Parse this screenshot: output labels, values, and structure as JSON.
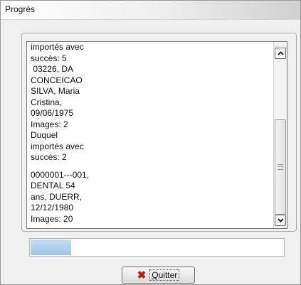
{
  "window": {
    "title": "Progrès"
  },
  "log": {
    "block1": "importés avec\nsuccès: 5\n 03226, DA\nCONCEICAO\nSILVA, Maria\nCristina,\n09/06/1975\nImages: 2\nDuquel\nimportés avec\nsuccès: 2",
    "block2": "0000001---001,\nDENTAL 54\nans, DUERR,\n12/12/1980\nImages: 20"
  },
  "scrollbar": {
    "up_icon": "chevron-up-icon",
    "down_icon": "chevron-down-icon"
  },
  "progress": {
    "value": 0.16,
    "fill_color": "#a9cbef"
  },
  "buttons": {
    "quit": {
      "mnemonic": "Q",
      "rest": "uitter",
      "icon": "red-x-icon",
      "icon_color": "#cc1010"
    }
  }
}
